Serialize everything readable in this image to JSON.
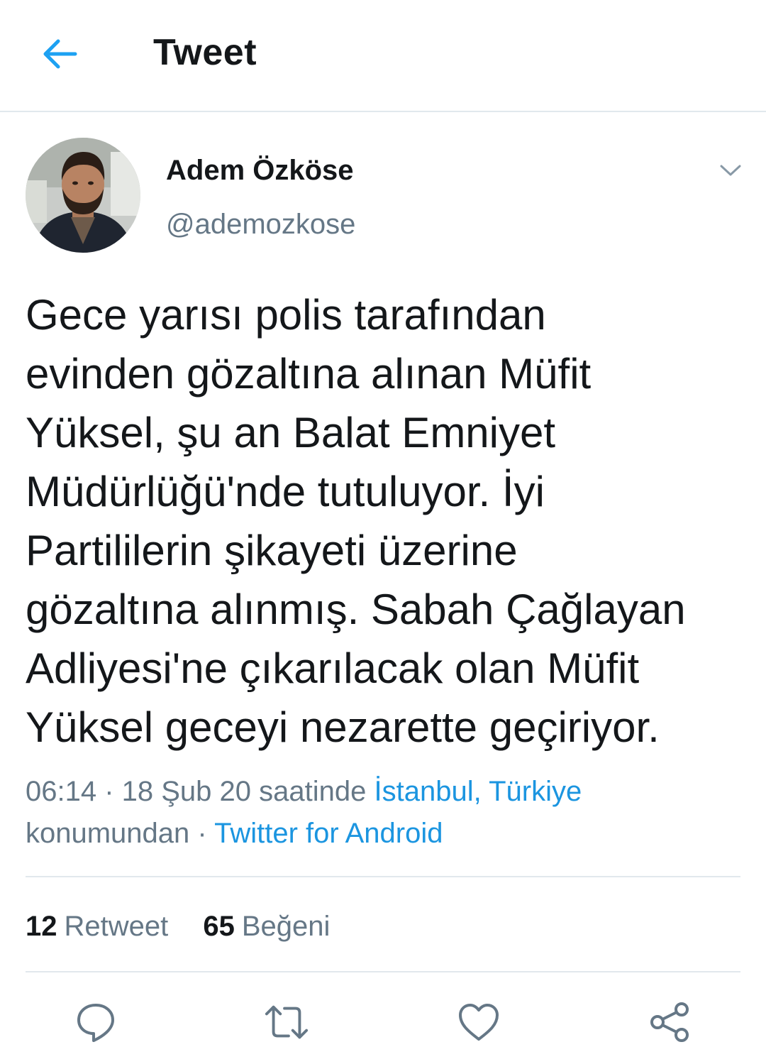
{
  "colors": {
    "accent": "#1da1f2",
    "link": "#1b95e0",
    "text": "#14171a",
    "secondary": "#657786",
    "divider": "#e1e8ed"
  },
  "header": {
    "back_icon": "arrow-left-icon",
    "title": "Tweet"
  },
  "author": {
    "name": "Adem Özköse",
    "handle": "@ademozkose",
    "menu_icon": "chevron-down-icon"
  },
  "tweet": {
    "lines": [
      "Gece yarısı polis tarafından",
      "evinden gözaltına alınan Müfit",
      "Yüksel, şu an Balat Emniyet",
      "Müdürlüğü'nde tutuluyor.  İyi",
      "Partililerin şikayeti üzerine",
      "gözaltına alınmış. Sabah Çağlayan",
      "Adliyesi'ne çıkarılacak olan Müfit",
      "Yüksel geceyi nezarette geçiriyor."
    ]
  },
  "meta": {
    "time_date": "06:14 · 18 Şub 20 saatinde ",
    "location": "İstanbul, Türkiye",
    "location_suffix": "konumundan · ",
    "source": "Twitter for Android"
  },
  "stats": {
    "retweet_count": "12",
    "retweet_label": "Retweet",
    "like_count": "65",
    "like_label": "Beğeni"
  },
  "actions": [
    {
      "icon": "reply-icon"
    },
    {
      "icon": "retweet-icon"
    },
    {
      "icon": "heart-icon"
    },
    {
      "icon": "share-icon"
    }
  ]
}
